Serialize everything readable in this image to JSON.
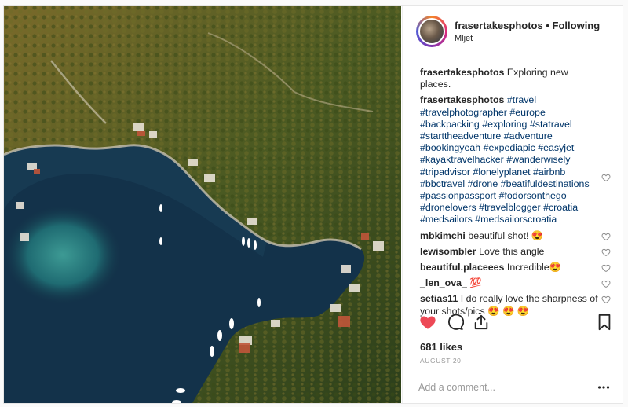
{
  "post": {
    "username": "frasertakesphotos",
    "follow_status": "Following",
    "separator": "•",
    "location": "Mljet",
    "image_alt": "Aerial view of bay with boats"
  },
  "caption": {
    "user": "frasertakesphotos",
    "text": "Exploring new places."
  },
  "hashtags_comment": {
    "user": "frasertakesphotos",
    "tags": [
      "#travel",
      "#travelphotographer",
      "#europe",
      "#backpacking",
      "#exploring",
      "#statravel",
      "#starttheadventure",
      "#adventure",
      "#bookingyeah",
      "#expediapic",
      "#easyjet",
      "#kayaktravelhacker",
      "#wanderwisely",
      "#tripadvisor",
      "#lonelyplanet",
      "#airbnb",
      "#bbctravel",
      "#drone",
      "#beatifuldestinations",
      "#passionpassport",
      "#fodorsonthego",
      "#dronelovers",
      "#travelblogger",
      "#croatia",
      "#medsailors",
      "#medsailorscroatia"
    ]
  },
  "comments": [
    {
      "user": "mbkimchi",
      "text": "beautiful shot! 😍"
    },
    {
      "user": "lewisombler",
      "text": "Love this angle"
    },
    {
      "user": "beautiful.placeees",
      "text": "Incredible😍"
    },
    {
      "user": "_len_ova_",
      "text": "💯"
    },
    {
      "user": "setias11",
      "text": "I do really love the sharpness of your shots/pics 😍 😍 😍"
    }
  ],
  "likes": "681 likes",
  "date": "AUGUST 20",
  "add_comment": {
    "placeholder": "Add a comment...",
    "more": "•••"
  },
  "colors": {
    "like_red": "#ed4956",
    "link_blue": "#003569",
    "muted_gray": "#999999"
  },
  "icons": {
    "like": "heart-filled-icon",
    "comment": "speech-bubble-icon",
    "share": "share-arrow-icon",
    "save": "bookmark-icon",
    "comment_like": "heart-outline-icon",
    "more": "more-dots-icon"
  }
}
